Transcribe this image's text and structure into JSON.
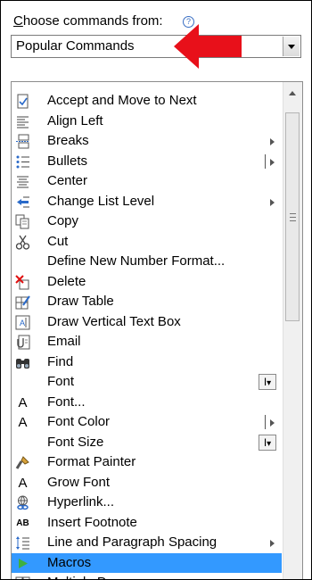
{
  "label": {
    "underlined_char": "C",
    "rest": "hoose commands from:"
  },
  "help_icon": "?",
  "combo": {
    "value": "Popular Commands"
  },
  "commands": [
    {
      "label": "Accept and Move to Next",
      "icon": "accept-icon"
    },
    {
      "label": "Align Left",
      "icon": "align-left-icon"
    },
    {
      "label": "Breaks",
      "icon": "breaks-icon",
      "submenu": true
    },
    {
      "label": "Bullets",
      "icon": "bullets-icon",
      "split": true
    },
    {
      "label": "Center",
      "icon": "center-icon"
    },
    {
      "label": "Change List Level",
      "icon": "change-list-level-icon",
      "submenu": true
    },
    {
      "label": "Copy",
      "icon": "copy-icon"
    },
    {
      "label": "Cut",
      "icon": "cut-icon"
    },
    {
      "label": "Define New Number Format...",
      "icon": ""
    },
    {
      "label": "Delete",
      "icon": "delete-icon"
    },
    {
      "label": "Draw Table",
      "icon": "draw-table-icon"
    },
    {
      "label": "Draw Vertical Text Box",
      "icon": "vertical-text-box-icon"
    },
    {
      "label": "Email",
      "icon": "email-icon"
    },
    {
      "label": "Find",
      "icon": "find-icon"
    },
    {
      "label": "Font",
      "icon": "",
      "fontbox": true
    },
    {
      "label": "Font...",
      "icon": "font-dialog-icon",
      "glyph": "A"
    },
    {
      "label": "Font Color",
      "icon": "font-color-icon",
      "glyph": "A",
      "split": true
    },
    {
      "label": "Font Size",
      "icon": "",
      "fontbox": true
    },
    {
      "label": "Format Painter",
      "icon": "format-painter-icon"
    },
    {
      "label": "Grow Font",
      "icon": "grow-font-icon",
      "glyph": "A"
    },
    {
      "label": "Hyperlink...",
      "icon": "hyperlink-icon"
    },
    {
      "label": "Insert Footnote",
      "icon": "insert-footnote-icon",
      "glyph": "AB"
    },
    {
      "label": "Line and Paragraph Spacing",
      "icon": "line-spacing-icon",
      "submenu": true
    },
    {
      "label": "Macros",
      "icon": "macros-icon",
      "selected": true
    },
    {
      "label": "Multiple Pages",
      "icon": "multiple-pages-icon"
    }
  ],
  "colors": {
    "selection": "#3399ff",
    "arrow": "#e8101a"
  }
}
